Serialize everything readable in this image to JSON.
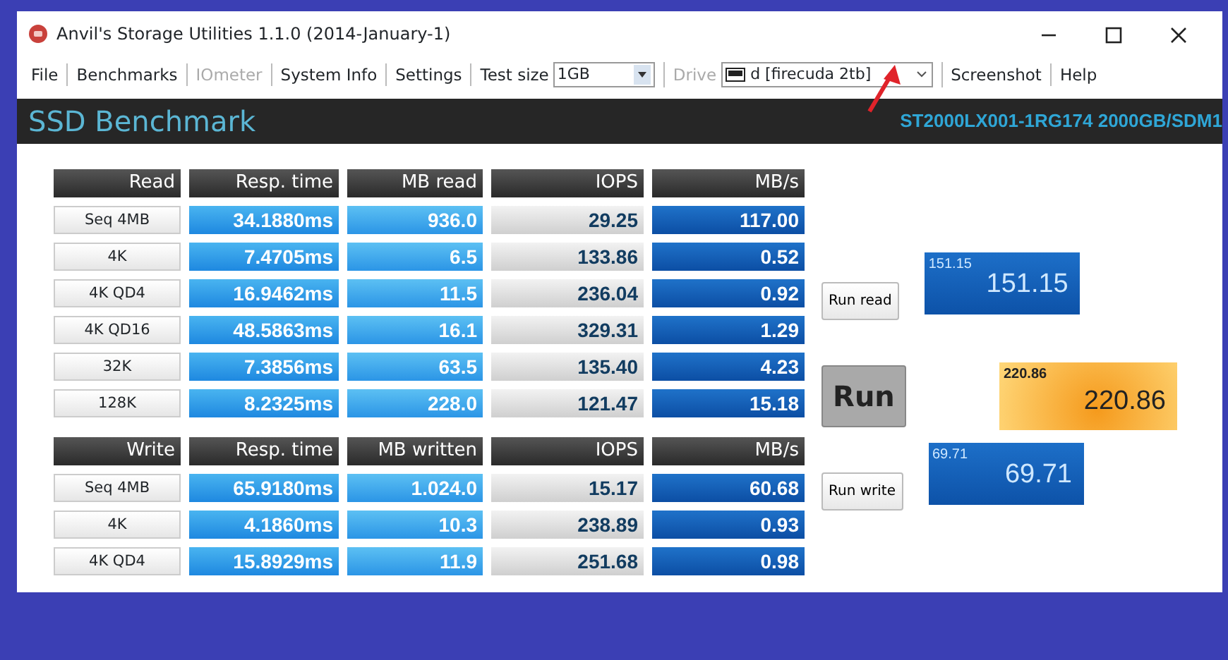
{
  "window": {
    "title": "Anvil's Storage Utilities 1.1.0 (2014-January-1)"
  },
  "toolbar": [
    {
      "kind": "menu",
      "label": "File",
      "disabled": false
    },
    {
      "kind": "menu",
      "label": "Benchmarks",
      "disabled": false
    },
    {
      "kind": "menu",
      "label": "IOmeter",
      "disabled": true
    },
    {
      "kind": "menu",
      "label": "System Info",
      "disabled": false
    },
    {
      "kind": "menu",
      "label": "Settings",
      "disabled": false
    },
    {
      "kind": "select",
      "label": "Test size",
      "value": "1GB",
      "disabled": false
    },
    {
      "kind": "drive",
      "label": "Drive",
      "value": "d [firecuda 2tb]",
      "disabled": true
    },
    {
      "kind": "menu",
      "label": "Screenshot",
      "disabled": false
    },
    {
      "kind": "menu",
      "label": "Help",
      "disabled": false
    }
  ],
  "header": {
    "title": "SSD Benchmark",
    "drive_info": "ST2000LX001-1RG174 2000GB/SDM1"
  },
  "tables": [
    {
      "columns": [
        "Read",
        "Resp. time",
        "MB read",
        "IOPS",
        "MB/s"
      ],
      "rows": [
        {
          "cells": [
            "Seq 4MB",
            "34.1880ms",
            "936.0",
            "29.25",
            "117.00"
          ]
        },
        {
          "cells": [
            "4K",
            "7.4705ms",
            "6.5",
            "133.86",
            "0.52"
          ]
        },
        {
          "cells": [
            "4K QD4",
            "16.9462ms",
            "11.5",
            "236.04",
            "0.92"
          ]
        },
        {
          "cells": [
            "4K QD16",
            "48.5863ms",
            "16.1",
            "329.31",
            "1.29"
          ]
        },
        {
          "cells": [
            "32K",
            "7.3856ms",
            "63.5",
            "135.40",
            "4.23"
          ]
        },
        {
          "cells": [
            "128K",
            "8.2325ms",
            "228.0",
            "121.47",
            "15.18"
          ]
        }
      ]
    },
    {
      "columns": [
        "Write",
        "Resp. time",
        "MB written",
        "IOPS",
        "MB/s"
      ],
      "rows": [
        {
          "cells": [
            "Seq 4MB",
            "65.9180ms",
            "1.024.0",
            "15.17",
            "60.68"
          ]
        },
        {
          "cells": [
            "4K",
            "4.1860ms",
            "10.3",
            "238.89",
            "0.93"
          ]
        },
        {
          "cells": [
            "4K QD4",
            "15.8929ms",
            "11.9",
            "251.68",
            "0.98"
          ]
        }
      ]
    }
  ],
  "scores": [
    {
      "kind": "read",
      "button": "Run read",
      "small": "151.15",
      "big": "151.15"
    },
    {
      "kind": "total",
      "button": "Run",
      "small": "220.86",
      "big": "220.86"
    },
    {
      "kind": "write",
      "button": "Run write",
      "small": "69.71",
      "big": "69.71"
    }
  ]
}
